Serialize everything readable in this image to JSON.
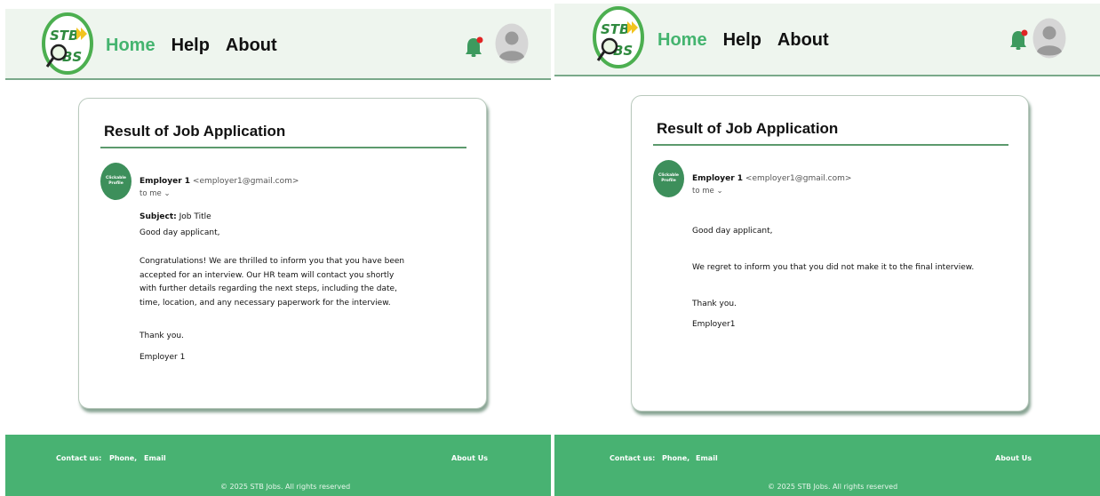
{
  "left": {
    "nav": {
      "home": "Home",
      "help": "Help",
      "about": "About"
    },
    "card": {
      "title": "Result of  Job Application",
      "profile_label": "Clickable Profile",
      "sender_name": "Employer 1",
      "sender_email": "<employer1@gmail.com>",
      "to_me": "to me ⌄",
      "subject_label": "Subject:",
      "subject_value": " Job Title",
      "greeting": "Good day applicant,",
      "message": "Congratulations! We are thrilled to inform you that you have been accepted for an interview.  Our HR team will contact you shortly with further details regarding the next steps, including the date, time, location, and any necessary paperwork for the interview.",
      "thanks": "Thank you.",
      "signature": "Employer 1"
    },
    "footer": {
      "contact": "Contact us:",
      "phone": "Phone,",
      "email": "Email",
      "about": "About Us",
      "copyright": "© 2025 STB Jobs. All rights reserved"
    }
  },
  "right": {
    "nav": {
      "home": "Home",
      "help": "Help",
      "about": "About"
    },
    "card": {
      "title": "Result of  Job Application",
      "profile_label": "Clickable Profile",
      "sender_name": "Employer 1",
      "sender_email": "<employer1@gmail.com>",
      "to_me": "to me ⌄",
      "greeting": "Good day applicant,",
      "message": "We regret to inform you that you did not make it to the final interview.",
      "thanks": "Thank you.",
      "signature": "Employer1"
    },
    "footer": {
      "contact": "Contact us:",
      "phone": "Phone,",
      "email": "Email",
      "about": "About Us",
      "copyright": "© 2025 STB Jobs. All rights reserved"
    }
  },
  "logo": {
    "text_top": "STB",
    "text_bottom": "JOBS"
  },
  "colors": {
    "accent": "#48b272",
    "header_bg": "#eef5ee",
    "profile": "#3d8f5b",
    "bell": "#3d9a5e",
    "bell_dot": "#e02424"
  },
  "icons": {
    "notification": "bell-icon",
    "user": "avatar-icon",
    "logo": "stb-jobs-logo",
    "dropdown": "chevron-down-icon"
  }
}
